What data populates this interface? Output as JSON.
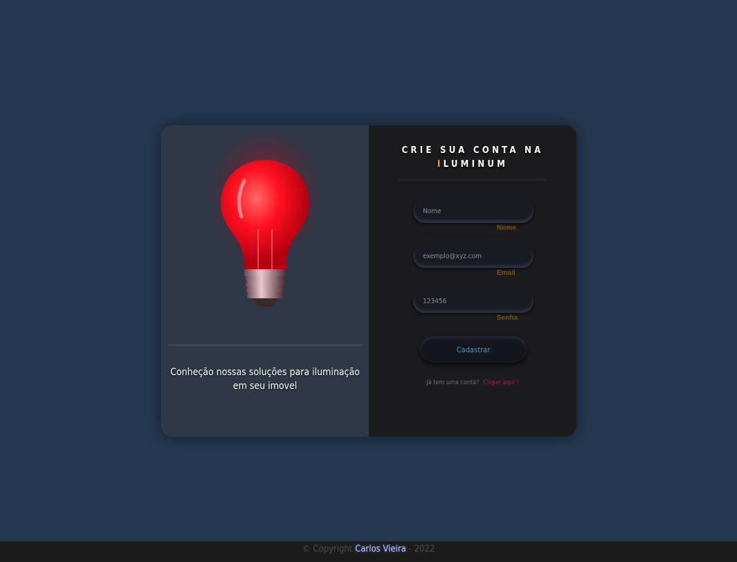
{
  "hero": {
    "tagline": "Conheção nossas soluções para iluminação em seu imovel"
  },
  "form": {
    "title_line1": "CRIE SUA CONTA NA",
    "title_accent": "I",
    "title_rest": "LUMINUM",
    "fields": [
      {
        "placeholder": "Nome",
        "label": "Nome"
      },
      {
        "placeholder": "exemplo@xyz.com",
        "label": "Email"
      },
      {
        "placeholder": "123456",
        "label": "Senha"
      }
    ],
    "submit_label": "Cadastrar",
    "login_prompt": "Já tem uma conta?",
    "login_link": "Clique aqui !"
  },
  "footer": {
    "prefix": "© Copyright",
    "author": "Carlos Vieira",
    "suffix": "- 2022"
  },
  "colors": {
    "background": "#243850",
    "accent": "#f0a020",
    "button_text": "#2a9fe0",
    "link": "#c01540"
  }
}
